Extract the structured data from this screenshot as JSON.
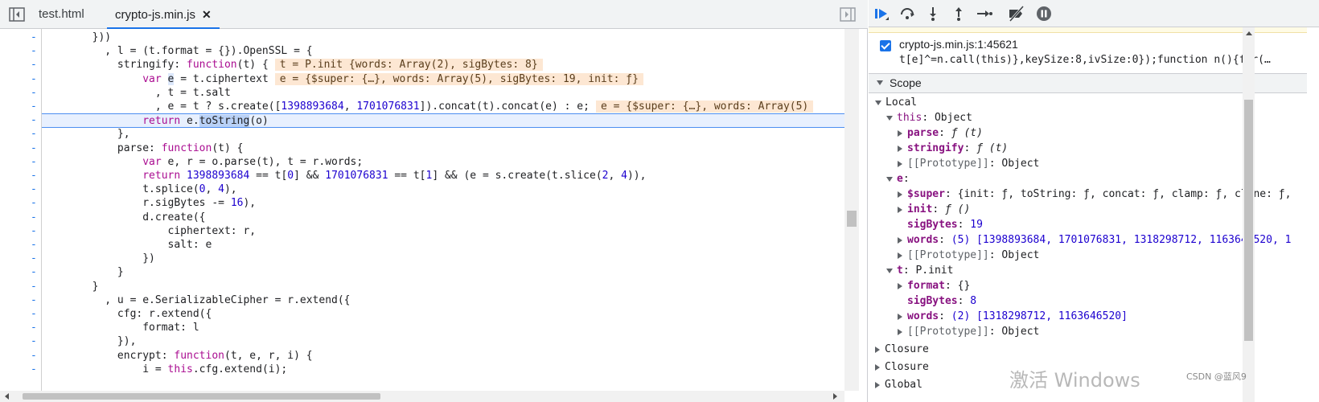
{
  "tabs": [
    {
      "label": "test.html"
    },
    {
      "label": "crypto-js.min.js",
      "close": "✕"
    }
  ],
  "gutter_marker": "-",
  "code_lines": [
    {
      "i": "        }))"
    },
    {
      "i": "          , l = (t.format = {}).OpenSSL = {"
    },
    {
      "i": "            stringify: ",
      "k": "function",
      "r": "(t) {",
      "v": "t = P.init {words: Array(2), sigBytes: 8}"
    },
    {
      "i": "                var e = t.ciphertext",
      "v": "e = {$super: {…}, words: Array(5), sigBytes: 19, init: ƒ}"
    },
    {
      "i": "                  , t = t.salt"
    },
    {
      "i": "                  , e = t ? s.create([1398893684, 1701076831]).concat(t).concat(e) : e;",
      "v": "e = {$super: {…}, words: Array(5)"
    },
    {
      "i": "                return e.toString(o)"
    },
    {
      "i": "            },"
    },
    {
      "i": "            parse: function(t) {"
    },
    {
      "i": "                var e, r = o.parse(t), t = r.words;"
    },
    {
      "i": "                return 1398893684 == t[0] && 1701076831 == t[1] && (e = s.create(t.slice(2, 4)),"
    },
    {
      "i": "                t.splice(0, 4),"
    },
    {
      "i": "                r.sigBytes -= 16),"
    },
    {
      "i": "                d.create({"
    },
    {
      "i": "                    ciphertext: r,"
    },
    {
      "i": "                    salt: e"
    },
    {
      "i": "                })"
    },
    {
      "i": "            }"
    },
    {
      "i": "        }"
    },
    {
      "i": "          , u = e.SerializableCipher = r.extend({"
    },
    {
      "i": "            cfg: r.extend({"
    },
    {
      "i": "                format: l"
    },
    {
      "i": "            }),"
    },
    {
      "i": "            encrypt: function(t, e, r, i) {"
    },
    {
      "i": "                i = this.cfg.extend(i);"
    }
  ],
  "breakpoint": {
    "label": "crypto-js.min.js:1:45621",
    "snippet": "t[e]^=n.call(this)},keySize:8,ivSize:0});function n(){for(…"
  },
  "scope": {
    "title": "Scope",
    "local": "Local",
    "this_name": "this",
    "this_val": "Object",
    "parse_name": "parse",
    "parse_val": "ƒ (t)",
    "stringify_name": "stringify",
    "stringify_val": "ƒ (t)",
    "proto_name": "[[Prototype]]",
    "proto_val": "Object",
    "e_name": "e",
    "super_name": "$super",
    "super_val": "{init: ƒ, toString: ƒ, concat: ƒ, clamp: ƒ, clone: ƒ,",
    "init_name": "init",
    "init_val": "ƒ ()",
    "sigbytes_name": "sigBytes",
    "e_sigbytes": "19",
    "words_name": "words",
    "e_words": "(5) [1398893684, 1701076831, 1318298712, 1163646520, 1",
    "t_name": "t",
    "t_val": "P.init",
    "format_name": "format",
    "format_val": "{}",
    "t_sigbytes": "8",
    "t_words": "(2) [1318298712, 1163646520]",
    "closure1": "Closure",
    "closure2": "Closure",
    "global": "Global"
  },
  "watermark": "激活 Windows",
  "credit": "CSDN @蓝风9"
}
